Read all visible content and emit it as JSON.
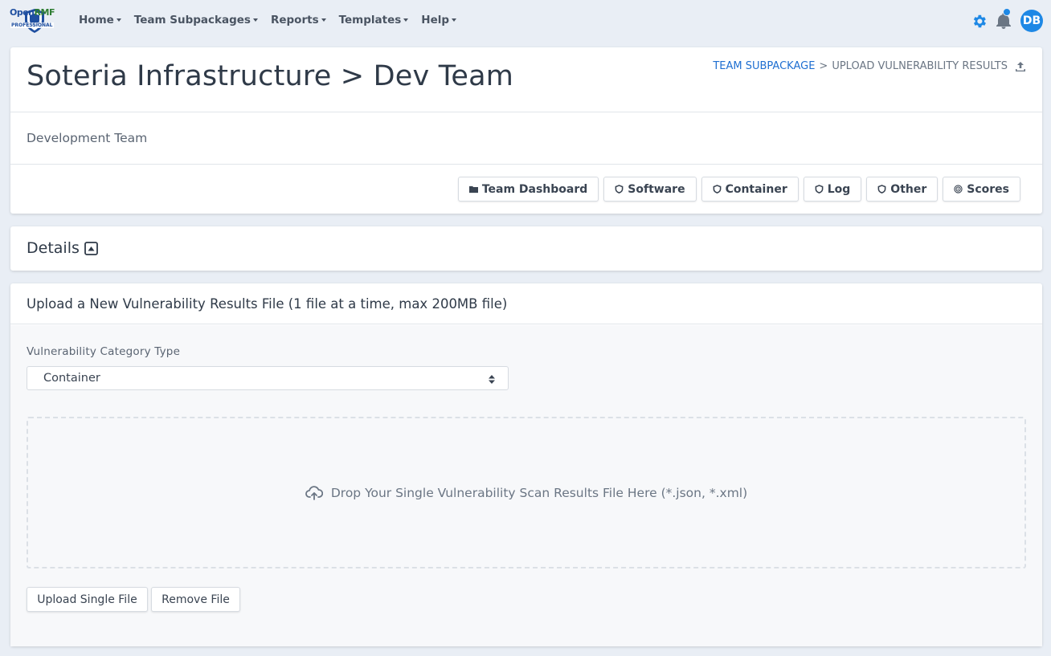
{
  "brand": {
    "logo_top_open": "Open",
    "logo_top_rmf": "RMF",
    "logo_bottom": "PROFESSIONAL"
  },
  "nav": {
    "items": [
      {
        "label": "Home"
      },
      {
        "label": "Team Subpackages"
      },
      {
        "label": "Reports"
      },
      {
        "label": "Templates"
      },
      {
        "label": "Help"
      }
    ],
    "avatar_initials": "DB"
  },
  "header": {
    "title": "Soteria Infrastructure > Dev Team",
    "breadcrumb": {
      "parent": "Team Subpackage",
      "separator": ">",
      "current": "Upload Vulnerability Results"
    },
    "subtitle": "Development Team"
  },
  "tabs": [
    {
      "label": "Team Dashboard",
      "icon": "folder-icon"
    },
    {
      "label": "Software",
      "icon": "shield-icon"
    },
    {
      "label": "Container",
      "icon": "shield-icon"
    },
    {
      "label": "Log",
      "icon": "shield-icon"
    },
    {
      "label": "Other",
      "icon": "shield-icon"
    },
    {
      "label": "Scores",
      "icon": "target-icon"
    }
  ],
  "details": {
    "title": "Details"
  },
  "upload": {
    "header": "Upload a New Vulnerability Results File (1 file at a time, max 200MB file)",
    "category_label": "Vulnerability Category Type",
    "category_value": "Container",
    "dropzone_text": "Drop Your Single Vulnerability Scan Results File Here (*.json, *.xml)",
    "upload_button": "Upload Single File",
    "remove_button": "Remove File"
  },
  "colors": {
    "accent": "#1e88e5",
    "link": "#1f6fd1",
    "background": "#e9eef5"
  }
}
